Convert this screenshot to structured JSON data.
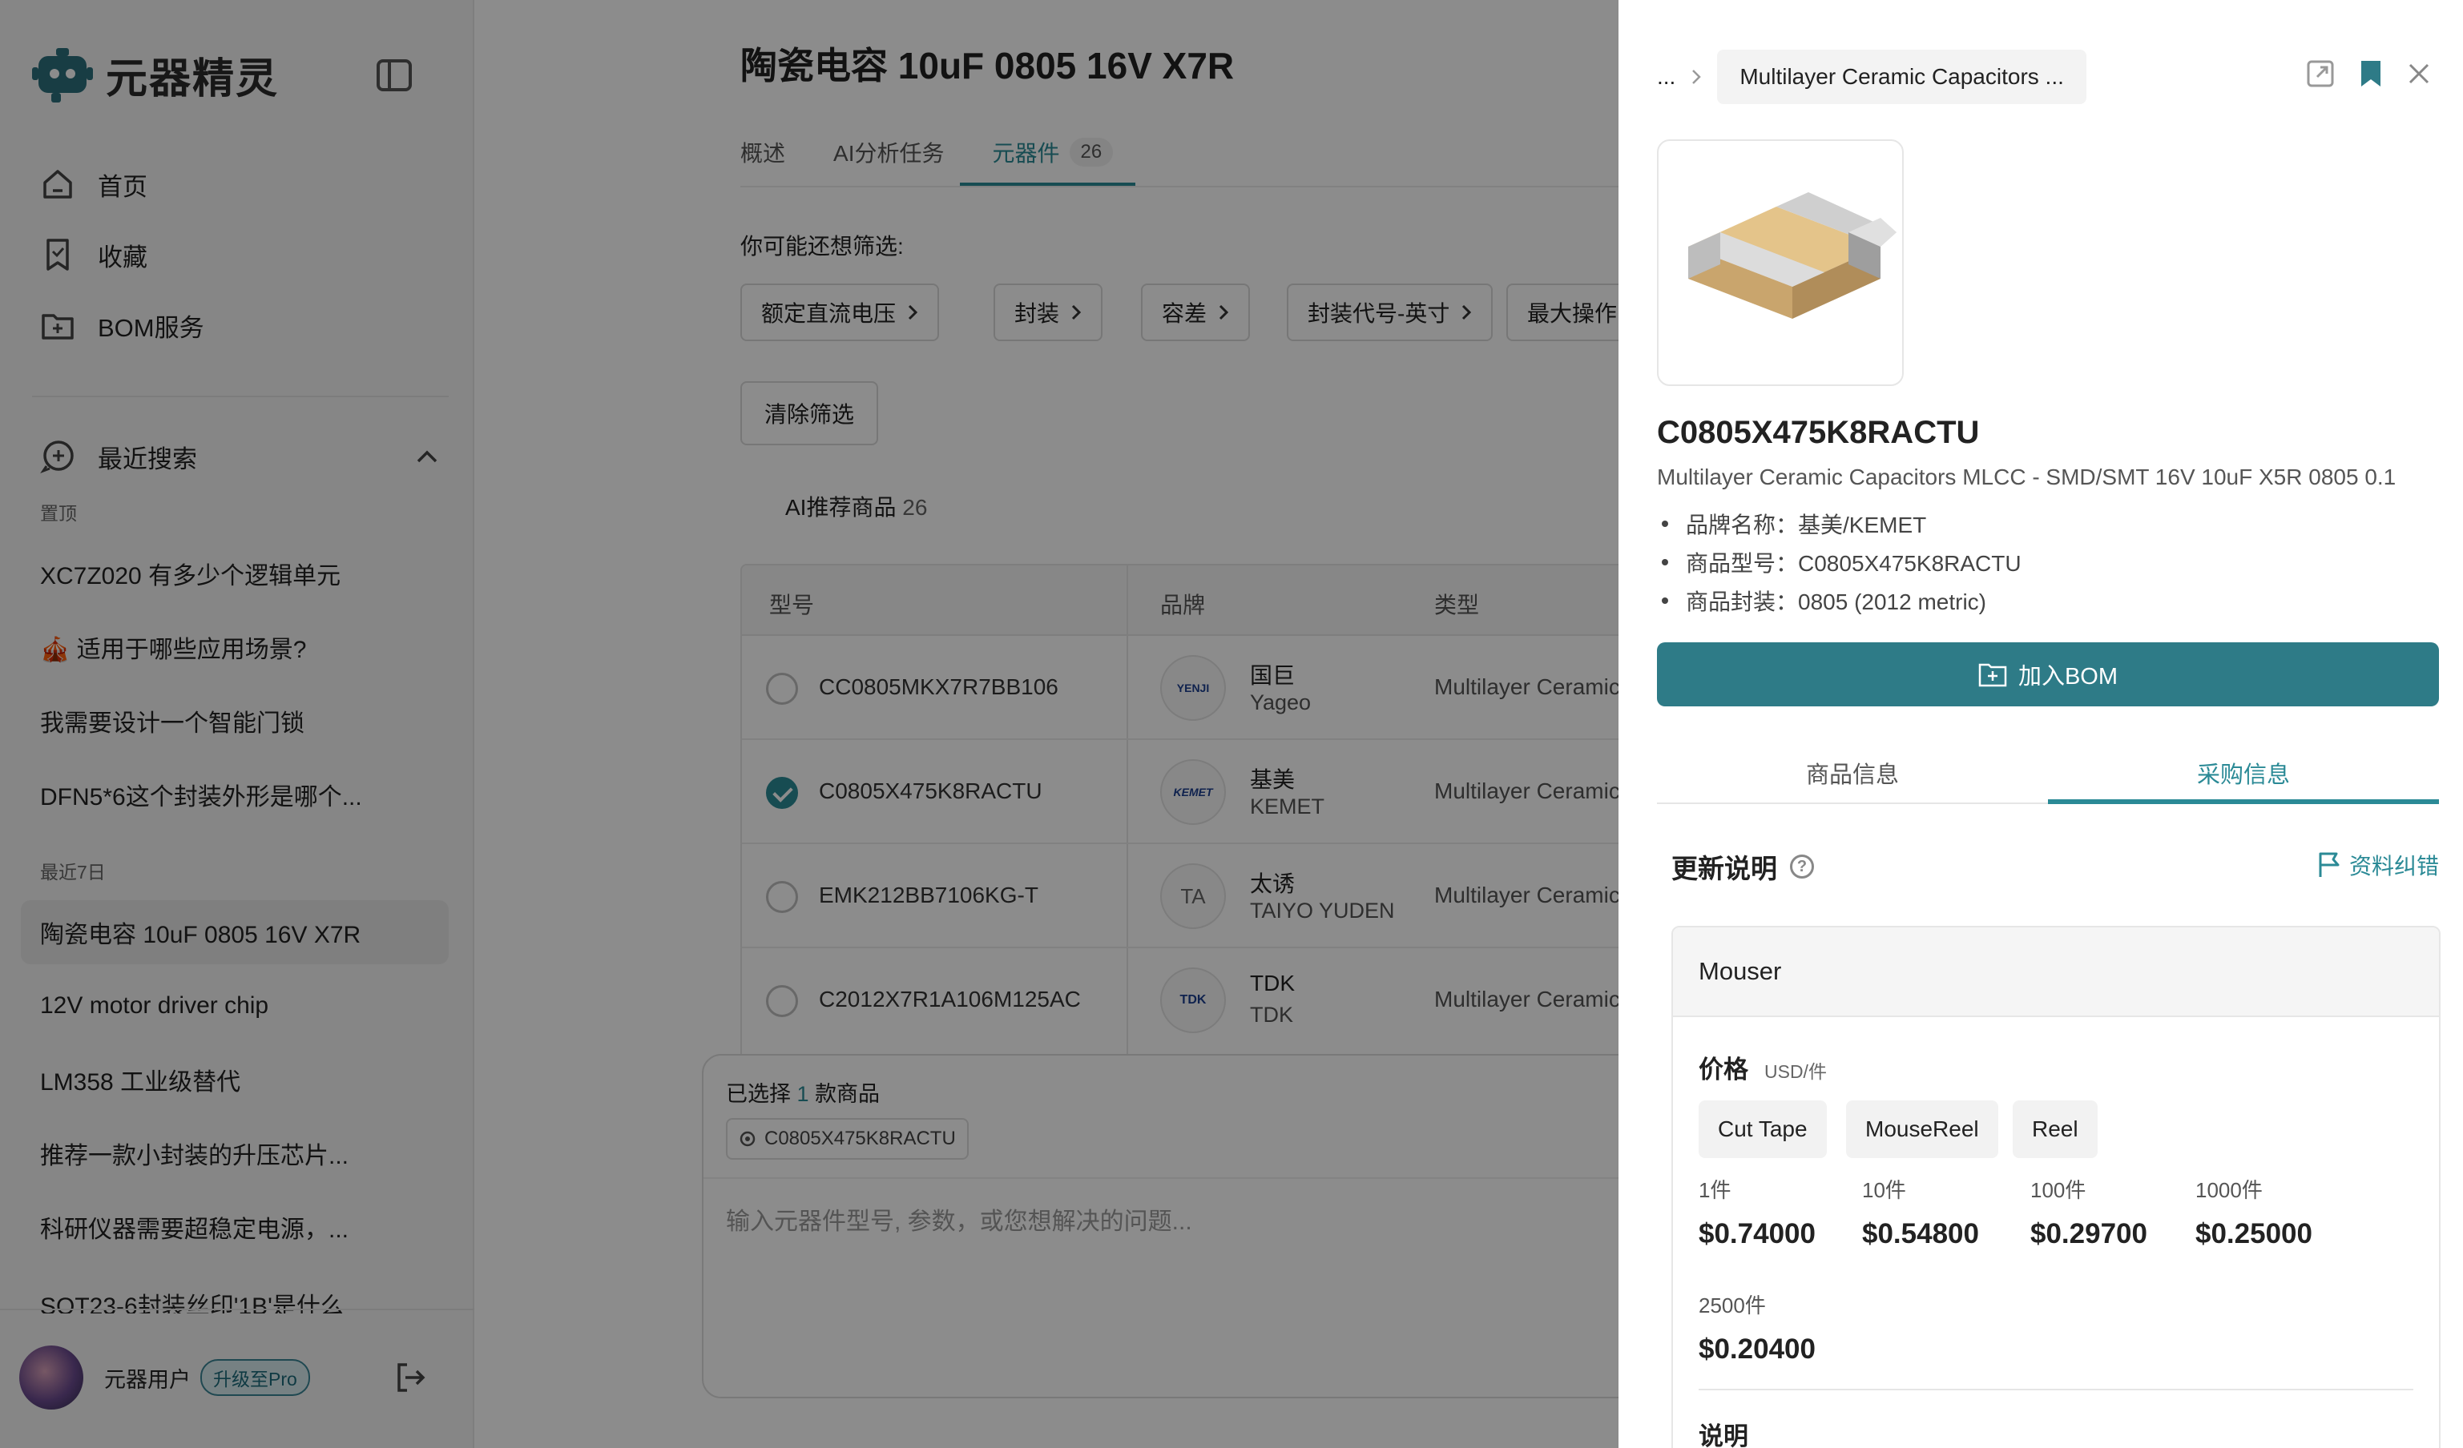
{
  "app": {
    "name": "元器精灵"
  },
  "nav": [
    {
      "label": "首页",
      "icon": "home-icon"
    },
    {
      "label": "收藏",
      "icon": "bookmark-icon"
    },
    {
      "label": "BOM服务",
      "icon": "folder-plus-icon"
    }
  ],
  "recent": {
    "title": "最近搜索",
    "pinned_label": "置顶",
    "pinned": [
      "XC7Z020 有多少个逻辑单元",
      "🎪 适用于哪些应用场景?",
      "我需要设计一个智能门锁",
      "DFN5*6这个封装外形是哪个..."
    ],
    "week_label": "最近7日",
    "week": [
      "陶瓷电容 10uF 0805 16V X7R",
      "12V motor driver chip",
      "LM358 工业级替代",
      "推荐一款小封装的升压芯片...",
      "科研仪器需要超稳定电源，...",
      "SOT23-6封装丝印'1B'是什么"
    ]
  },
  "user": {
    "name": "元器用户",
    "upgrade": "升级至Pro"
  },
  "main": {
    "title": "陶瓷电容 10uF 0805 16V X7R",
    "tabs": [
      {
        "label": "概述"
      },
      {
        "label": "AI分析任务"
      },
      {
        "label": "元器件",
        "count": "26"
      }
    ],
    "filter_prompt": "你可能还想筛选:",
    "filters": [
      "额定直流电压",
      "封装",
      "容差",
      "封装代号-英寸",
      "最大操作"
    ],
    "clear_label": "清除筛选",
    "ai_label": "AI推荐商品",
    "ai_count": "26",
    "table": {
      "headers": [
        "型号",
        "品牌",
        "类型"
      ],
      "rows": [
        {
          "model": "CC0805MKX7R7BB106",
          "brand_cn": "国巨",
          "brand_en": "Yageo",
          "logo": "YENJI",
          "type": "Multilayer Ceramic",
          "checked": false
        },
        {
          "model": "C0805X475K8RACTU",
          "brand_cn": "基美",
          "brand_en": "KEMET",
          "logo": "KEMET",
          "type": "Multilayer Ceramic",
          "checked": true
        },
        {
          "model": "EMK212BB7106KG-T",
          "brand_cn": "太诱",
          "brand_en": "TAIYO YUDEN",
          "logo": "TA",
          "type": "Multilayer Ceramic",
          "checked": false
        },
        {
          "model": "C2012X7R1A106M125AC",
          "brand_cn": "TDK",
          "brand_en": "TDK",
          "logo": "TDK",
          "type": "Multilayer Ceramic",
          "checked": false
        }
      ]
    },
    "selection": {
      "prefix": "已选择",
      "count": "1",
      "suffix": "款商品",
      "chip": "C0805X475K8RACTU"
    },
    "input_placeholder": "输入元器件型号, 参数，或您想解决的问题..."
  },
  "drawer": {
    "breadcrumb_ellipsis": "...",
    "breadcrumb_current": "Multilayer Ceramic Capacitors ...",
    "part_number": "C0805X475K8RACTU",
    "description": "Multilayer Ceramic Capacitors MLCC - SMD/SMT 16V 10uF X5R 0805 0.1",
    "specs": [
      "品牌名称：基美/KEMET",
      "商品型号：C0805X475K8RACTU",
      "商品封装：0805 (2012 metric)"
    ],
    "add_bom": "加入BOM",
    "tabs": [
      "商品信息",
      "采购信息"
    ],
    "active_tab": "采购信息",
    "update_title": "更新说明",
    "report_label": "资料纠错",
    "supplier": "Mouser",
    "price_label": "价格",
    "price_unit": "USD/件",
    "packages": [
      "Cut Tape",
      "MouseReel",
      "Reel"
    ],
    "tiers": [
      {
        "qty": "1件",
        "price": "$0.74000"
      },
      {
        "qty": "10件",
        "price": "$0.54800"
      },
      {
        "qty": "100件",
        "price": "$0.29700"
      },
      {
        "qty": "1000件",
        "price": "$0.25000"
      },
      {
        "qty": "2500件",
        "price": "$0.20400"
      }
    ],
    "note_label": "说明"
  }
}
